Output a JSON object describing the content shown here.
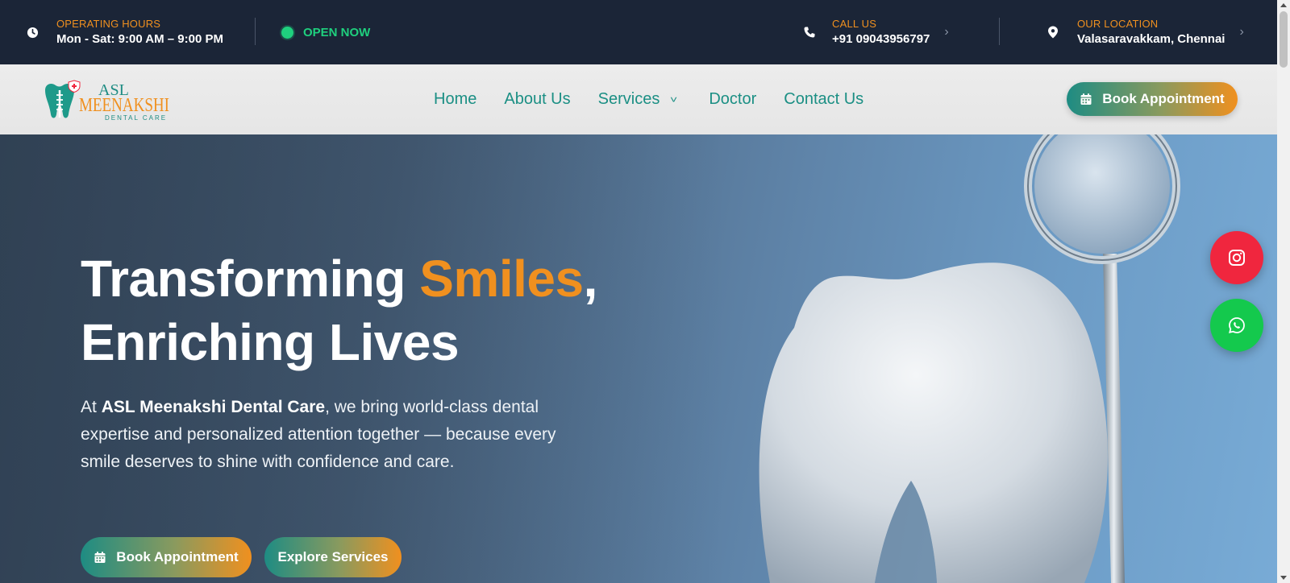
{
  "topbar": {
    "hours_label": "OPERATING HOURS",
    "hours_value": "Mon - Sat: 9:00 AM – 9:00 PM",
    "status": "OPEN NOW",
    "call_label": "CALL US",
    "call_value": "+91 09043956797",
    "location_label": "OUR LOCATION",
    "location_value": "Valasaravakkam, Chennai"
  },
  "nav": {
    "logo_line1": "ASL",
    "logo_line2": "MEENAKSHI",
    "logo_line3": "DENTAL CARE",
    "links": [
      "Home",
      "About Us",
      "Services",
      "Doctor",
      "Contact Us"
    ],
    "cta": "Book Appointment"
  },
  "hero": {
    "title_part1": "Transforming ",
    "title_accent": "Smiles",
    "title_part2": ",",
    "title_line2": "Enriching Lives",
    "desc_prefix": "At ",
    "desc_bold": "ASL Meenakshi Dental Care",
    "desc_rest": ", we bring world-class dental expertise and personalized attention together — because every smile deserves to shine with confidence and care.",
    "btn_primary": "Book Appointment",
    "btn_secondary": "Explore Services"
  },
  "colors": {
    "topbar_bg": "#1b2537",
    "accent_orange": "#f0901f",
    "brand_teal": "#1b8f84",
    "open_green": "#1fd07e",
    "instagram_red": "#f0263e",
    "whatsapp_green": "#14c94d"
  },
  "icons": {
    "hours": "clock-icon",
    "status": "status-dot-icon",
    "call": "phone-icon",
    "location": "map-pin-icon",
    "calendar": "calendar-icon",
    "instagram": "instagram-icon",
    "whatsapp": "whatsapp-icon"
  }
}
